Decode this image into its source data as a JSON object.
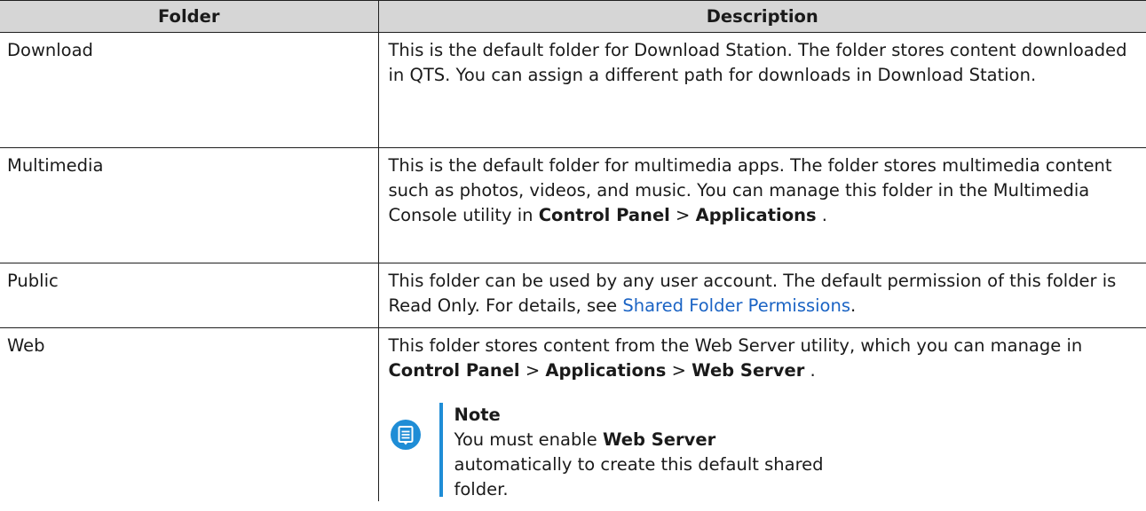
{
  "colors": {
    "header_bg": "#d6d6d6",
    "link": "#1a63c4",
    "note_accent": "#1f8dd6",
    "border": "#1f1f1f"
  },
  "table": {
    "headers": {
      "folder": "Folder",
      "description": "Description"
    },
    "rows": [
      {
        "folder": "Download",
        "desc": "This is the default folder for Download Station. The folder stores content downloaded in QTS. You can assign a different path for downloads in Download Station."
      },
      {
        "folder": "Multimedia",
        "desc_intro": "This is the default folder for multimedia apps. The folder stores multimedia content such as photos, videos, and music. You can manage this folder in the Multimedia Console utility in ",
        "path_1": "Control Panel",
        "sep_1": " > ",
        "path_2": "Applications",
        "end": " ."
      },
      {
        "folder": "Public",
        "desc_intro": "This folder can be used by any user account. The default permission of this folder is Read Only. For details, see ",
        "link": "Shared Folder Permissions",
        "end": "."
      },
      {
        "folder": "Web",
        "desc_intro": "This folder stores content from the Web Server utility, which you can manage in ",
        "path_1": "Control Panel",
        "sep_1": " > ",
        "path_2": "Applications",
        "sep_2": " > ",
        "path_3": "Web Server",
        "end": " .",
        "note": {
          "icon": "note-icon",
          "title": "Note",
          "text_intro": "You must enable ",
          "text_bold": "Web Server",
          "text_end": " automatically to create this default shared folder."
        }
      }
    ]
  }
}
